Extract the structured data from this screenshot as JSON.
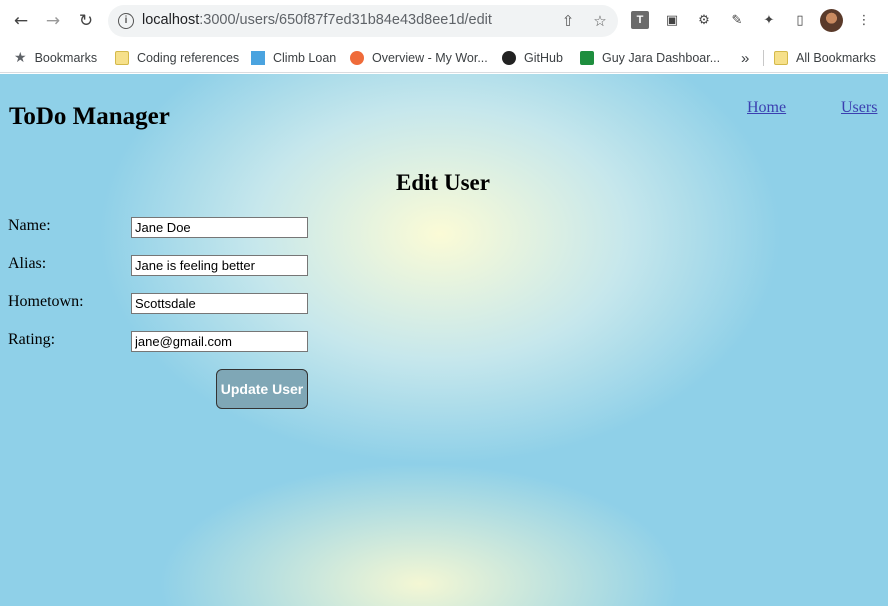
{
  "browser": {
    "url_host": "localhost",
    "url_path": ":3000/users/650f87f7ed31b84e43d8ee1d/edit",
    "back_icon": "←",
    "forward_icon": "→",
    "reload_icon": "↻",
    "info_icon": "i",
    "share_icon": "⇧",
    "star_icon": "☆",
    "ext_t_label": "T",
    "image_icon": "▣",
    "gear_icon": "⚙",
    "dropper_icon": "✎",
    "puzzle_icon": "✦",
    "sidepanel_icon": "▯",
    "menu_icon": "⋮"
  },
  "bookmarks": {
    "items": [
      {
        "label": "Bookmarks"
      },
      {
        "label": "Coding references"
      },
      {
        "label": "Climb Loan"
      },
      {
        "label": "Overview - My Wor..."
      },
      {
        "label": "GitHub"
      },
      {
        "label": "Guy Jara Dashboar..."
      }
    ],
    "overflow_icon": "»",
    "all_bookmarks": "All Bookmarks"
  },
  "site": {
    "title": "ToDo Manager",
    "nav": {
      "home": "Home",
      "users": "Users"
    }
  },
  "form": {
    "title": "Edit User",
    "fields": {
      "name": {
        "label": "Name:",
        "value": "Jane Doe"
      },
      "alias": {
        "label": "Alias:",
        "value": "Jane is feeling better"
      },
      "hometown": {
        "label": "Hometown:",
        "value": "Scottsdale"
      },
      "rating": {
        "label": "Rating:",
        "value": "jane@gmail.com"
      }
    },
    "submit_label": "Update User"
  }
}
